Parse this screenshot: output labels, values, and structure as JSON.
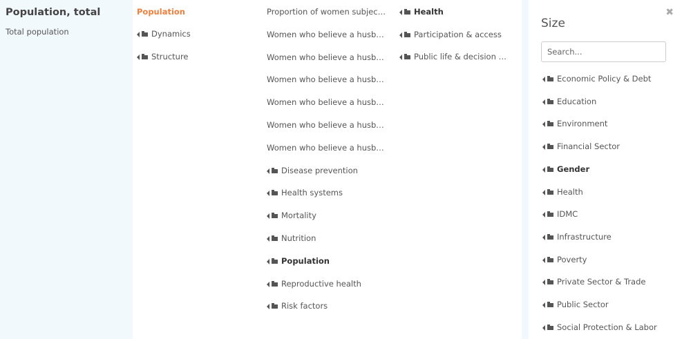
{
  "info": {
    "title": "Population, total",
    "subtitle": "Total population"
  },
  "col1": {
    "active": "Population",
    "items": [
      "Dynamics",
      "Structure"
    ]
  },
  "col2": {
    "items": [
      {
        "label": "Proportion of women subjec…",
        "folder": false,
        "bold": false
      },
      {
        "label": "Women who believe a husb…",
        "folder": false,
        "bold": false
      },
      {
        "label": "Women who believe a husb…",
        "folder": false,
        "bold": false
      },
      {
        "label": "Women who believe a husb…",
        "folder": false,
        "bold": false
      },
      {
        "label": "Women who believe a husb…",
        "folder": false,
        "bold": false
      },
      {
        "label": "Women who believe a husb…",
        "folder": false,
        "bold": false
      },
      {
        "label": "Women who believe a husb…",
        "folder": false,
        "bold": false
      },
      {
        "label": "Disease prevention",
        "folder": true,
        "bold": false
      },
      {
        "label": "Health systems",
        "folder": true,
        "bold": false
      },
      {
        "label": "Mortality",
        "folder": true,
        "bold": false
      },
      {
        "label": "Nutrition",
        "folder": true,
        "bold": false
      },
      {
        "label": "Population",
        "folder": true,
        "bold": true
      },
      {
        "label": "Reproductive health",
        "folder": true,
        "bold": false
      },
      {
        "label": "Risk factors",
        "folder": true,
        "bold": false
      }
    ]
  },
  "col3": {
    "items": [
      {
        "label": "Health",
        "bold": true
      },
      {
        "label": "Participation & access",
        "bold": false
      },
      {
        "label": "Public life & decision …",
        "bold": false
      }
    ]
  },
  "size_panel": {
    "title": "Size",
    "close_glyph": "✖",
    "search_placeholder": "Search...",
    "items": [
      {
        "label": "Economic Policy & Debt",
        "bold": false
      },
      {
        "label": "Education",
        "bold": false
      },
      {
        "label": "Environment",
        "bold": false
      },
      {
        "label": "Financial Sector",
        "bold": false
      },
      {
        "label": "Gender",
        "bold": true
      },
      {
        "label": "Health",
        "bold": false
      },
      {
        "label": "IDMC",
        "bold": false
      },
      {
        "label": "Infrastructure",
        "bold": false
      },
      {
        "label": "Poverty",
        "bold": false
      },
      {
        "label": "Private Sector & Trade",
        "bold": false
      },
      {
        "label": "Public Sector",
        "bold": false
      },
      {
        "label": "Social Protection & Labor",
        "bold": false
      }
    ]
  },
  "colors": {
    "active": "#f07f3c",
    "info_bg": "#f2f9fd",
    "text": "#555555"
  }
}
